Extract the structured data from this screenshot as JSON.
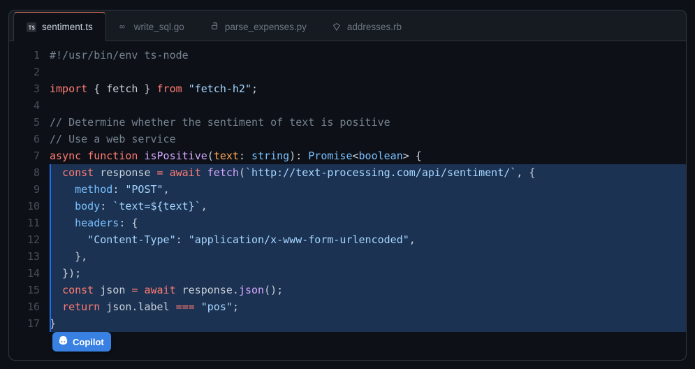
{
  "tabs": [
    {
      "label": "sentiment.ts",
      "active": true,
      "lang": "ts"
    },
    {
      "label": "write_sql.go",
      "active": false,
      "lang": "go"
    },
    {
      "label": "parse_expenses.py",
      "active": false,
      "lang": "py"
    },
    {
      "label": "addresses.rb",
      "active": false,
      "lang": "rb"
    }
  ],
  "copilot_label": "Copilot",
  "line_count": 17,
  "code_lines": [
    {
      "n": 1,
      "hl": false,
      "tokens": [
        [
          "c-comment",
          "#!/usr/bin/env ts-node"
        ]
      ]
    },
    {
      "n": 2,
      "hl": false,
      "tokens": [
        [
          "",
          ""
        ]
      ]
    },
    {
      "n": 3,
      "hl": false,
      "tokens": [
        [
          "c-key",
          "import"
        ],
        [
          "",
          " { "
        ],
        [
          "c-var",
          "fetch"
        ],
        [
          "",
          " } "
        ],
        [
          "c-key",
          "from"
        ],
        [
          "",
          " "
        ],
        [
          "c-str",
          "\"fetch-h2\""
        ],
        [
          "c-punc",
          ";"
        ]
      ]
    },
    {
      "n": 4,
      "hl": false,
      "tokens": [
        [
          "",
          ""
        ]
      ]
    },
    {
      "n": 5,
      "hl": false,
      "tokens": [
        [
          "c-comment",
          "// Determine whether the sentiment of text is positive"
        ]
      ]
    },
    {
      "n": 6,
      "hl": false,
      "tokens": [
        [
          "c-comment",
          "// Use a web service"
        ]
      ]
    },
    {
      "n": 7,
      "hl": false,
      "tokens": [
        [
          "c-key",
          "async"
        ],
        [
          "",
          " "
        ],
        [
          "c-key",
          "function"
        ],
        [
          "",
          " "
        ],
        [
          "c-func",
          "isPositive"
        ],
        [
          "c-punc",
          "("
        ],
        [
          "c-param",
          "text"
        ],
        [
          "c-punc",
          ": "
        ],
        [
          "c-type",
          "string"
        ],
        [
          "c-punc",
          "): "
        ],
        [
          "c-type",
          "Promise"
        ],
        [
          "c-punc",
          "<"
        ],
        [
          "c-bool",
          "boolean"
        ],
        [
          "c-punc",
          "> {"
        ]
      ]
    },
    {
      "n": 8,
      "hl": true,
      "tokens": [
        [
          "",
          "  "
        ],
        [
          "c-key",
          "const"
        ],
        [
          "",
          " "
        ],
        [
          "c-var",
          "response"
        ],
        [
          "",
          " "
        ],
        [
          "c-op",
          "="
        ],
        [
          "",
          " "
        ],
        [
          "c-key",
          "await"
        ],
        [
          "",
          " "
        ],
        [
          "c-funccall",
          "fetch"
        ],
        [
          "c-punc",
          "("
        ],
        [
          "c-template",
          "`http://text-processing.com/api/sentiment/`"
        ],
        [
          "c-punc",
          ", {"
        ]
      ]
    },
    {
      "n": 9,
      "hl": true,
      "tokens": [
        [
          "",
          "    "
        ],
        [
          "c-prop",
          "method"
        ],
        [
          "c-punc",
          ": "
        ],
        [
          "c-str",
          "\"POST\""
        ],
        [
          "c-punc",
          ","
        ]
      ]
    },
    {
      "n": 10,
      "hl": true,
      "tokens": [
        [
          "",
          "    "
        ],
        [
          "c-prop",
          "body"
        ],
        [
          "c-punc",
          ": "
        ],
        [
          "c-template",
          "`text=${text}`"
        ],
        [
          "c-punc",
          ","
        ]
      ]
    },
    {
      "n": 11,
      "hl": true,
      "tokens": [
        [
          "",
          "    "
        ],
        [
          "c-prop",
          "headers"
        ],
        [
          "c-punc",
          ": {"
        ]
      ]
    },
    {
      "n": 12,
      "hl": true,
      "tokens": [
        [
          "",
          "      "
        ],
        [
          "c-str",
          "\"Content-Type\""
        ],
        [
          "c-punc",
          ": "
        ],
        [
          "c-str",
          "\"application/x-www-form-urlencoded\""
        ],
        [
          "c-punc",
          ","
        ]
      ]
    },
    {
      "n": 13,
      "hl": true,
      "tokens": [
        [
          "",
          "    },"
        ],
        [
          "",
          ""
        ]
      ]
    },
    {
      "n": 14,
      "hl": true,
      "tokens": [
        [
          "",
          "  });"
        ]
      ]
    },
    {
      "n": 15,
      "hl": true,
      "tokens": [
        [
          "",
          "  "
        ],
        [
          "c-key",
          "const"
        ],
        [
          "",
          " "
        ],
        [
          "c-var",
          "json"
        ],
        [
          "",
          " "
        ],
        [
          "c-op",
          "="
        ],
        [
          "",
          " "
        ],
        [
          "c-key",
          "await"
        ],
        [
          "",
          " "
        ],
        [
          "c-var",
          "response."
        ],
        [
          "c-funccall",
          "json"
        ],
        [
          "c-punc",
          "();"
        ]
      ]
    },
    {
      "n": 16,
      "hl": true,
      "tokens": [
        [
          "",
          "  "
        ],
        [
          "c-key",
          "return"
        ],
        [
          "",
          " "
        ],
        [
          "c-var",
          "json"
        ],
        [
          "c-punc",
          "."
        ],
        [
          "c-var",
          "label"
        ],
        [
          "",
          " "
        ],
        [
          "c-op",
          "==="
        ],
        [
          "",
          " "
        ],
        [
          "c-str",
          "\"pos\""
        ],
        [
          "c-punc",
          ";"
        ]
      ]
    },
    {
      "n": 17,
      "hl": true,
      "tokens": [
        [
          "c-punc",
          "}"
        ]
      ]
    }
  ]
}
